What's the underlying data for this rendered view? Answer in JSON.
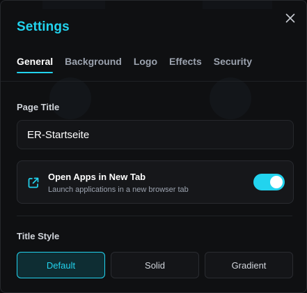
{
  "dialog": {
    "title": "Settings",
    "close_icon": "close-icon"
  },
  "tabs": [
    {
      "label": "General",
      "active": true
    },
    {
      "label": "Background",
      "active": false
    },
    {
      "label": "Logo",
      "active": false
    },
    {
      "label": "Effects",
      "active": false
    },
    {
      "label": "Security",
      "active": false
    }
  ],
  "page_title": {
    "label": "Page Title",
    "value": "ER-Startseite"
  },
  "open_apps": {
    "icon": "external-link-icon",
    "title": "Open Apps in New Tab",
    "description": "Launch applications in a new browser tab",
    "enabled": true
  },
  "title_style": {
    "label": "Title Style",
    "options": [
      {
        "label": "Default",
        "selected": true
      },
      {
        "label": "Solid",
        "selected": false
      },
      {
        "label": "Gradient",
        "selected": false
      }
    ]
  },
  "colors": {
    "accent": "#22d3ee",
    "background": "#0f1012",
    "text": "#ffffff",
    "muted": "#9ca3af"
  }
}
